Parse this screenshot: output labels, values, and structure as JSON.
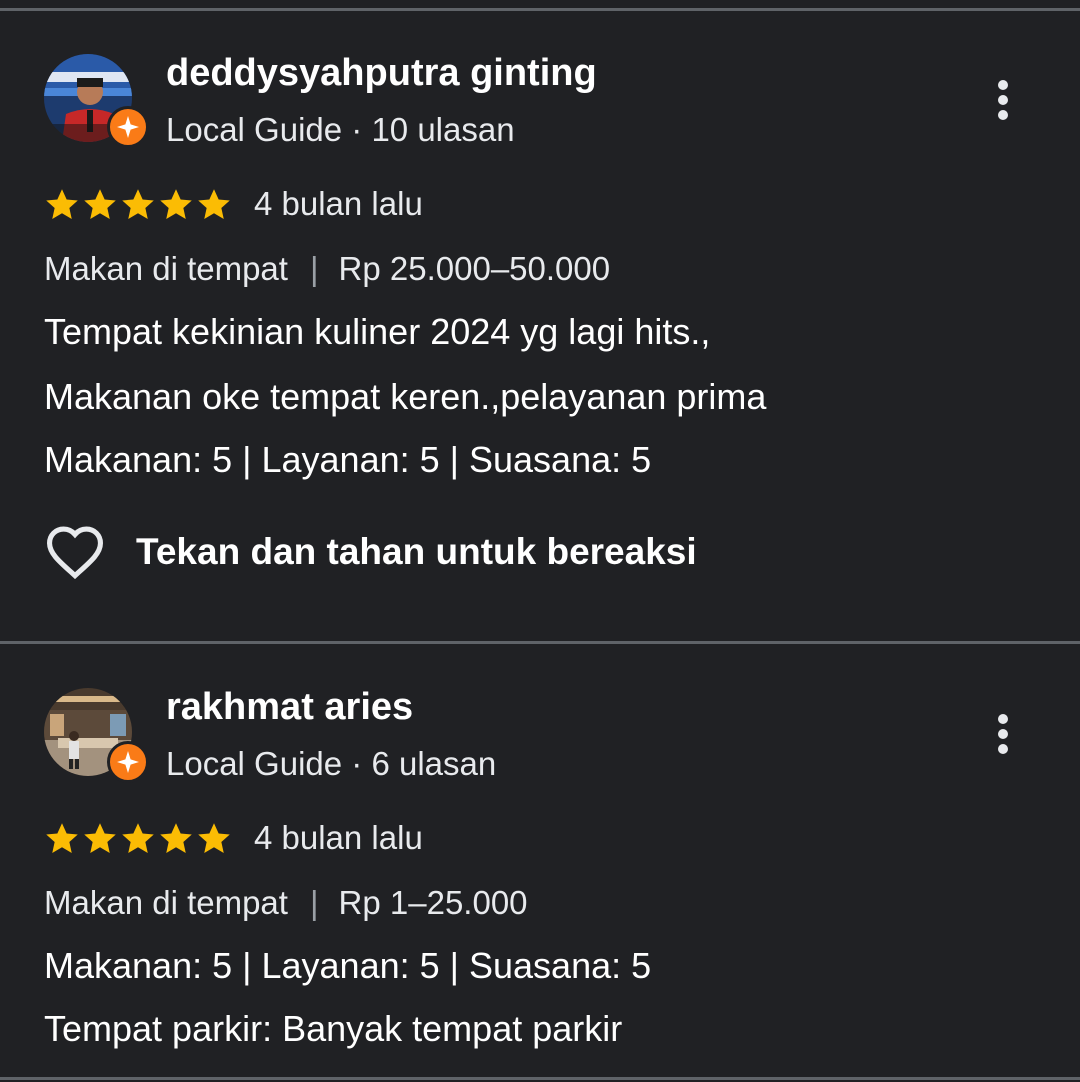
{
  "reviews": [
    {
      "name": "deddysyahputra ginting",
      "meta": "Local Guide · 10 ulasan",
      "rating": 5,
      "time": "4 bulan lalu",
      "service_type": "Makan di tempat",
      "separator": "|",
      "price": "Rp 25.000–50.000",
      "text_lines": [
        "Tempat kekinian kuliner 2024 yg lagi hits.,",
        "Makanan oke tempat keren.,pelayanan prima",
        "Makanan: 5 | Layanan: 5 | Suasana: 5"
      ],
      "react_label": "Tekan dan tahan untuk bereaksi"
    },
    {
      "name": "rakhmat aries",
      "meta": "Local Guide · 6 ulasan",
      "rating": 5,
      "time": "4 bulan lalu",
      "service_type": "Makan di tempat",
      "separator": "|",
      "price": "Rp 1–25.000",
      "text_lines": [
        "Makanan: 5 | Layanan: 5 | Suasana: 5",
        "Tempat parkir: Banyak tempat parkir"
      ]
    }
  ],
  "colors": {
    "background": "#202124",
    "star": "#fbbc04",
    "local_guide_badge": "#fa7b17",
    "divider": "#5f6368"
  },
  "icons": {
    "star": "star-icon",
    "badge": "local-guide-icon",
    "more": "more-vert-icon",
    "react": "heart-outline-icon"
  }
}
